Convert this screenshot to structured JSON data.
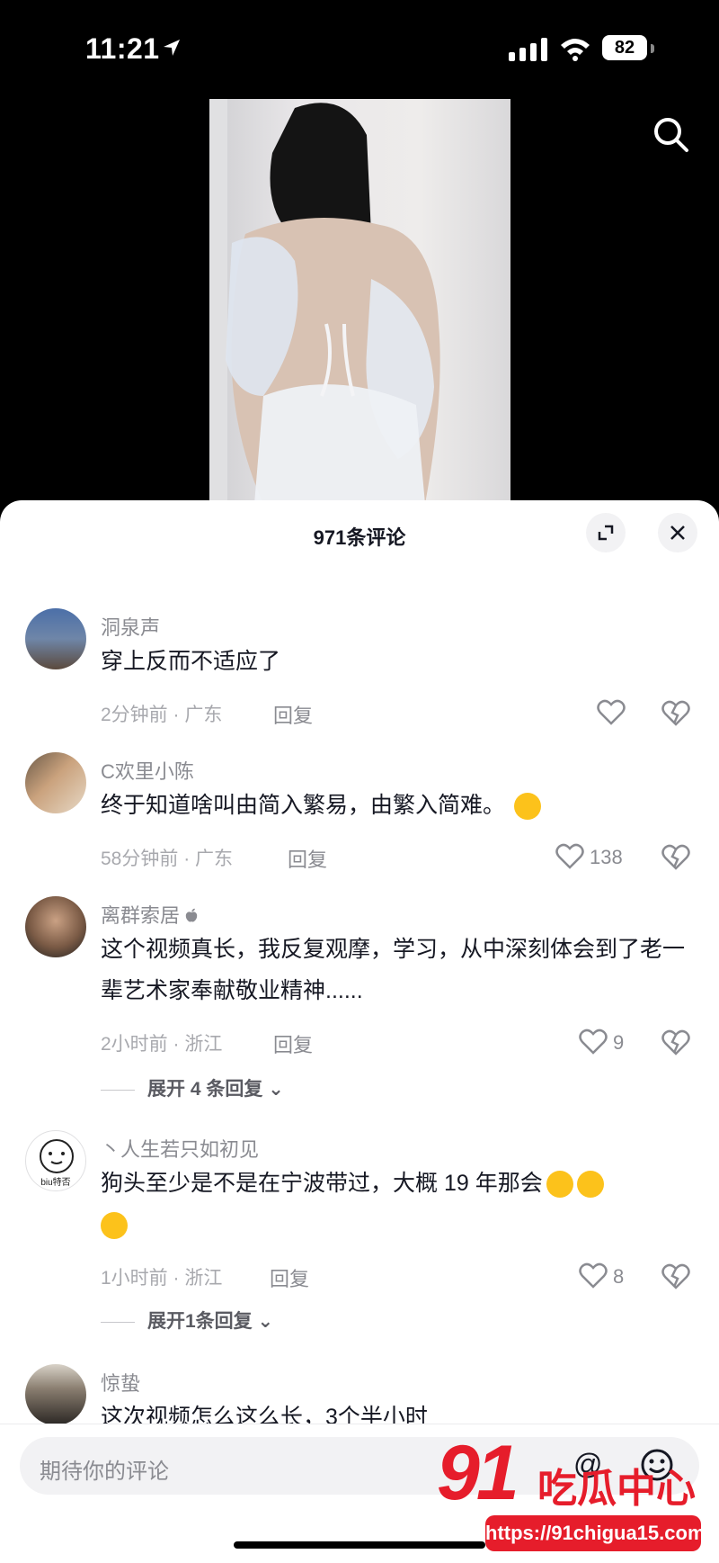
{
  "status_bar": {
    "time": "11:21",
    "battery": "82"
  },
  "sheet": {
    "title": "971条评论"
  },
  "comments": [
    {
      "user": "洞泉声",
      "text": "穿上反而不适应了",
      "time_location": "2分钟前 · 广东",
      "reply_label": "回复",
      "likes": ""
    },
    {
      "user": "C欢里小陈",
      "text": "终于知道啥叫由简入繁易，由繁入简难。",
      "time_location": "58分钟前 · 广东",
      "reply_label": "回复",
      "likes": "138"
    },
    {
      "user": "离群索居",
      "text": "这个视频真长，我反复观摩，学习，从中深刻体会到了老一辈艺术家奉献敬业精神......",
      "time_location": "2小时前 · 浙江",
      "reply_label": "回复",
      "likes": "9",
      "expand": "展开 4 条回复"
    },
    {
      "user": "丶人生若只如初见",
      "text": "狗头至少是不是在宁波带过，大概 19 年那会",
      "time_location": "1小时前 · 浙江",
      "reply_label": "回复",
      "likes": "8",
      "expand": "展开1条回复",
      "avatar_text": "biu特否"
    },
    {
      "user": "惊蛰",
      "text": "这次视频怎么这么长，3个半小时"
    }
  ],
  "input": {
    "placeholder": "期待你的评论",
    "at": "@"
  },
  "watermark": {
    "logo": "91",
    "slogan": "吃瓜中心",
    "url": "https://91chigua15.com"
  },
  "colors": {
    "accent": "#e61d2b",
    "muted": "#8a8b91"
  }
}
